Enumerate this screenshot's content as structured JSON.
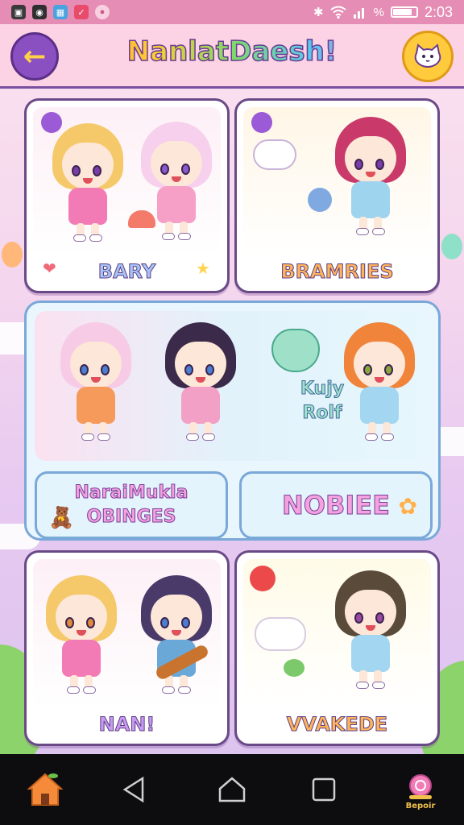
{
  "status_bar": {
    "time": "2:03",
    "battery_symbol": "%",
    "battery_level": 0.85,
    "icons": [
      "photo-icon",
      "camera-icon",
      "gallery-icon",
      "checkmark-app-icon",
      "ball-app-icon",
      "bluetooth-icon",
      "wifi-icon",
      "signal-icon"
    ]
  },
  "header": {
    "title": "NanlatDaesh!",
    "back_icon": "arrow-left-icon",
    "profile_icon": "cat-icon"
  },
  "cards": [
    {
      "label": "BARY",
      "color": "#a7c4f5"
    },
    {
      "label": "BRAMRIES",
      "color": "#ffb45a"
    },
    {
      "label": "NAN!",
      "color": "#c89bf0"
    },
    {
      "label": "VVAKEDE",
      "color": "#ffb45a"
    }
  ],
  "feature": {
    "caption_line1": "Kujy",
    "caption_line2": "Rolf",
    "button_left_line1": "NaraiMukla",
    "button_left_line2": "OBINGES",
    "button_right": "NOBIEE"
  },
  "navbar": {
    "home_icon": "house-icon",
    "back_icon": "triangle-back-icon",
    "home_button_icon": "house-outline-icon",
    "recents_icon": "square-recents-icon",
    "extra_label": "Bepoir",
    "extra_icon": "pink-snail-icon"
  },
  "colors": {
    "status_bar": "#e58db4",
    "header": "#fbd3e4",
    "accent_purple": "#8a4fc0",
    "accent_yellow": "#ffcb3d"
  }
}
